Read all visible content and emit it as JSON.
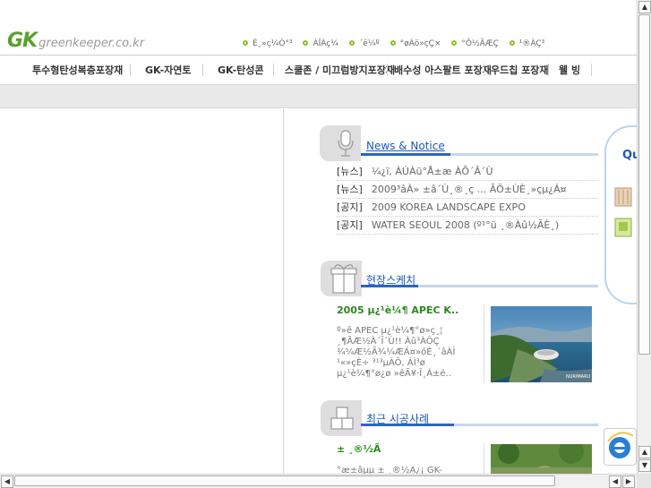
{
  "header": {
    "logo_mark": "GK",
    "logo_site": "greenkeeper.co.kr",
    "top_links": [
      "È¸»ç¼Ò°³",
      "ÀÎÀç¼",
      "´ë¼º",
      "°øÁö»çÇ×",
      "°Ô½ÃÆÇ",
      "¹®ÀÇ³"
    ]
  },
  "menu": {
    "items": [
      "투수형탄성복층포장재",
      "GK-자연토",
      "GK-탄성콘",
      "스쿨존 / 미끄럼방지포장재",
      "배수성 아스팔트 포장재",
      "우드칩 포장재",
      "웰 빙"
    ]
  },
  "news": {
    "title": "News & Notice",
    "items": [
      {
        "category": "[뉴스]",
        "text": "¼¿ï, ÀÚÀü°Å±æ ÀÕ´Â´Ù"
      },
      {
        "category": "[뉴스]",
        "text": "2009³âÀ» ±â´Ù¸®¸ç ... ÃÖ±ÙÈ¸»çµ¿Á¤"
      },
      {
        "category": "[공지]",
        "text": "2009 KOREA LANDSCAPE EXPO"
      },
      {
        "category": "[공지]",
        "text": "WATER SEOUL 2008 (º¹°ü ¸®Àû½ÃÈ¸)"
      }
    ]
  },
  "sketch": {
    "title": "현장스케치",
    "post_title": "2005 µ¿¹è¼¶ APEC K..",
    "post_body": "º»ê APEC µ¿¹è¼¶°ø»ç¸¦ ¸¶ÃÆ½À´Ï´Ù!! Àû³ÀÔÇ ¾¼Æ½Ã¾¼ÆÁ¤»óÉ¸´âÀÌ ¹«»çÈ÷ ³¹³µÀÔ, ÀÌ³ø µ¿¹è¼¶°ø¿ø »êÃ¥·Î¸Á±ë..",
    "photo_caption": "NURIMARU"
  },
  "recent": {
    "title": "최근 시공사례",
    "post_title": "± ¸®½Ã",
    "post_body": "°æ±âµµ ± ¸®½Ã¿¡ GK-"
  },
  "quick": {
    "label": "Qu"
  }
}
